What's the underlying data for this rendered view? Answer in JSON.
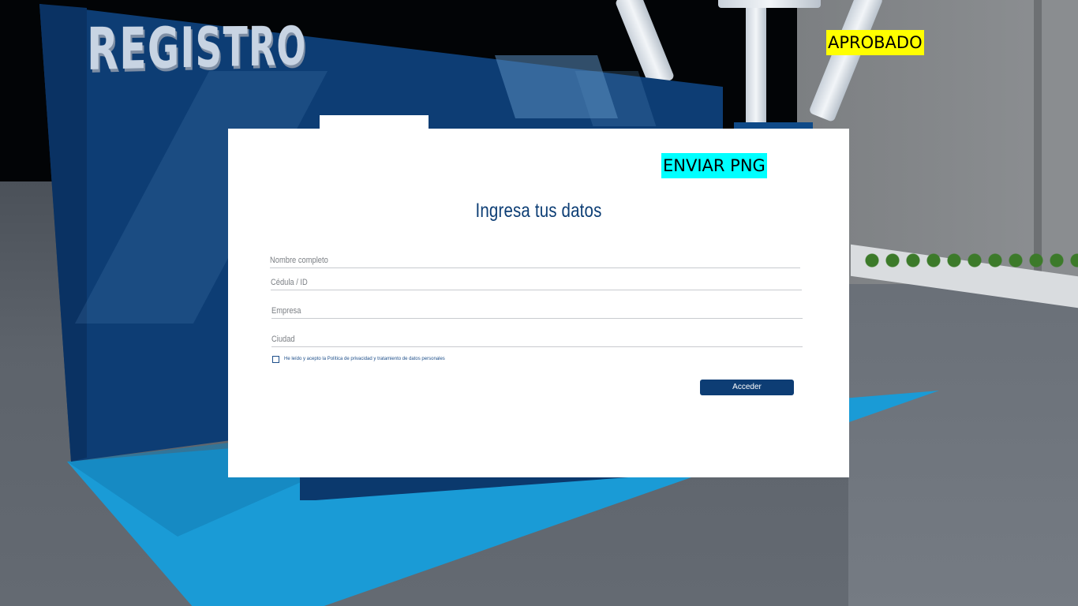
{
  "scene": {
    "booth_sign": "REGISTRO",
    "colors": {
      "booth_blue": "#0d3d74",
      "carpet_cyan": "#1a9bd6",
      "floor_gray": "#5d636b"
    }
  },
  "overlay": {
    "approved_label": "APROBADO",
    "send_png_label": "ENVIAR PNG",
    "approved_color": "#ffff00",
    "send_color": "#00ffff"
  },
  "form": {
    "title": "Ingresa tus datos",
    "fields": [
      {
        "label": "Nombre completo"
      },
      {
        "label": "Cédula / ID"
      },
      {
        "label": "Empresa"
      },
      {
        "label": "Ciudad"
      }
    ],
    "consent_text": "He leído y acepto la Política de privacidad y tratamiento de datos personales",
    "consent_checked": false,
    "submit_label": "Acceder",
    "accent_color": "#0d3e75"
  }
}
